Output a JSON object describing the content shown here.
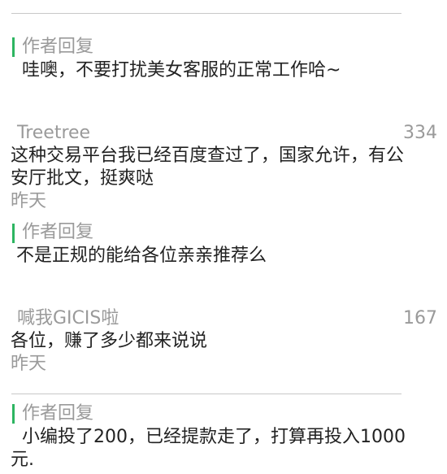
{
  "threads": [
    {
      "author_reply": {
        "label": "作者回复",
        "text": "哇噢，不要打扰美女客服的正常工作哈~"
      }
    },
    {
      "username": "Treetree",
      "likes": "334",
      "content_line1": "这种交易平台我已经百度查过了，国家允许，有公",
      "content_line2": "安厅批文，挺爽哒",
      "time": "昨天",
      "author_reply": {
        "label": "作者回复",
        "text": "不是正规的能给各位亲亲推荐么"
      }
    },
    {
      "username": "喊我GICIS啦",
      "likes": "167",
      "content": "各位，赚了多少都来说说",
      "time": "昨天",
      "author_reply": {
        "label": "作者回复",
        "text_line1": "小编投了200，已经提款走了，打算再投入1000",
        "text_line2": "元."
      }
    }
  ],
  "colors": {
    "accent_bar": "#2db561",
    "muted_text": "#9a9a9a",
    "body_text": "#222222",
    "divider": "#c8c8c8"
  }
}
